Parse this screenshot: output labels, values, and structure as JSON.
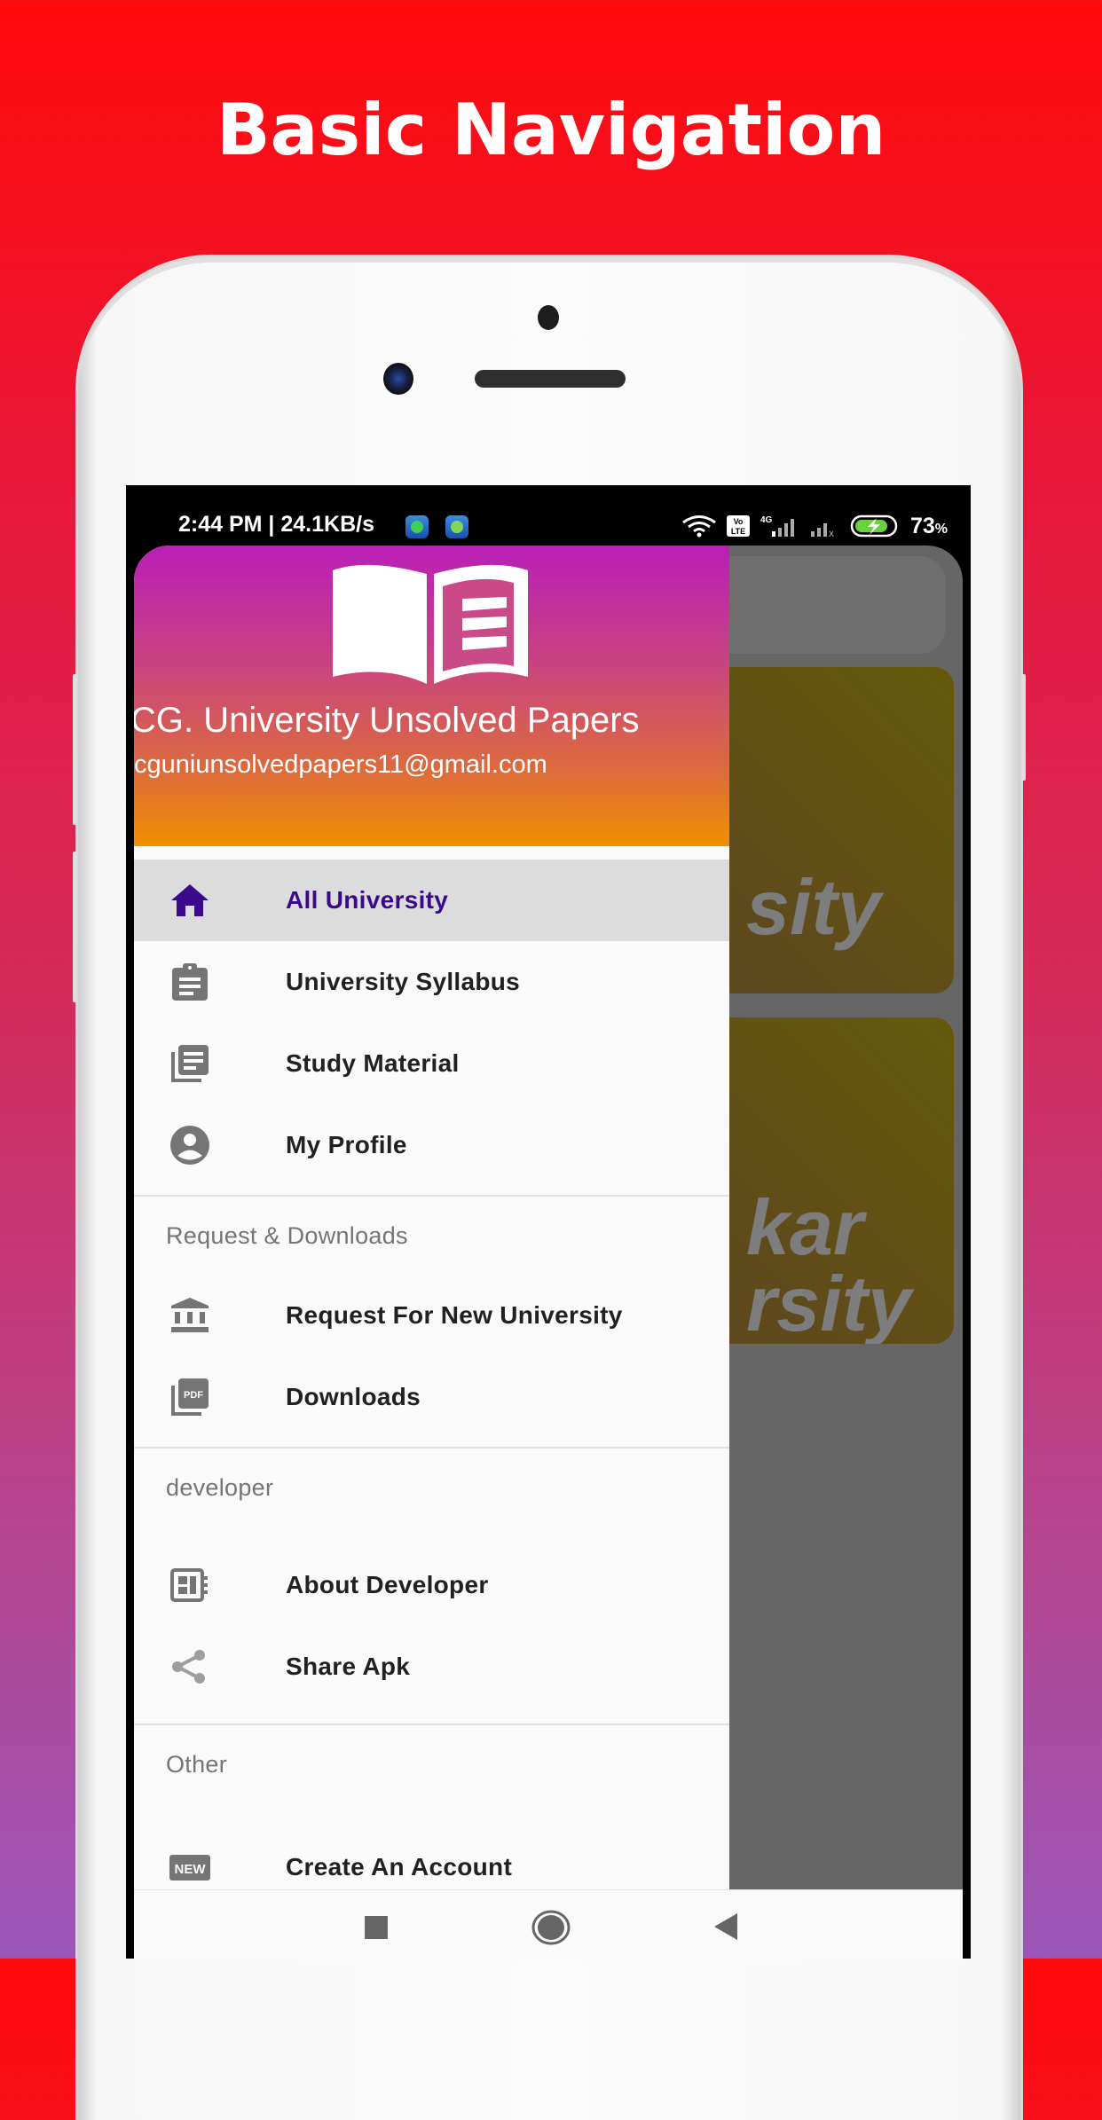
{
  "promo": {
    "title": "Basic Navigation"
  },
  "status_bar": {
    "time_speed": "2:44 PM | 24.1KB/s",
    "network": "4G",
    "volte": "Vo LTE",
    "battery_percent": "73",
    "battery_suffix": "%"
  },
  "drawer": {
    "header": {
      "app_name": "CG. University Unsolved Papers",
      "email": "cguniunsolvedpapers11@gmail.com",
      "logo": "open-book-icon"
    },
    "primary_items": [
      {
        "label": "All University",
        "icon": "home-icon",
        "active": true
      },
      {
        "label": "University Syllabus",
        "icon": "clipboard-icon",
        "active": false
      },
      {
        "label": "Study Material",
        "icon": "library-books-icon",
        "active": false
      },
      {
        "label": "My Profile",
        "icon": "account-circle-icon",
        "active": false
      }
    ],
    "sections": [
      {
        "title": "Request & Downloads",
        "items": [
          {
            "label": "Request For New University",
            "icon": "bank-icon"
          },
          {
            "label": "Downloads",
            "icon": "pdf-icon"
          }
        ]
      },
      {
        "title": "developer",
        "items": [
          {
            "label": "About Developer",
            "icon": "developer-board-icon"
          },
          {
            "label": "Share Apk",
            "icon": "share-icon"
          }
        ]
      },
      {
        "title": "Other",
        "items": [
          {
            "label": "Create An Account",
            "icon": "new-badge-icon"
          }
        ]
      }
    ]
  },
  "background_app": {
    "cards": [
      {
        "partial_text": "sity"
      },
      {
        "partial_text_line1": "kar",
        "partial_text_line2": "rsity"
      }
    ]
  },
  "nav_bar": {
    "buttons": [
      "recents",
      "home",
      "back"
    ]
  },
  "colors": {
    "active_item_text": "#3b0a8c",
    "active_item_bg": "#dcdcdc",
    "header_gradient_top": "#b91fb8",
    "header_gradient_bottom": "#f09000",
    "icon_gray": "#757575"
  }
}
